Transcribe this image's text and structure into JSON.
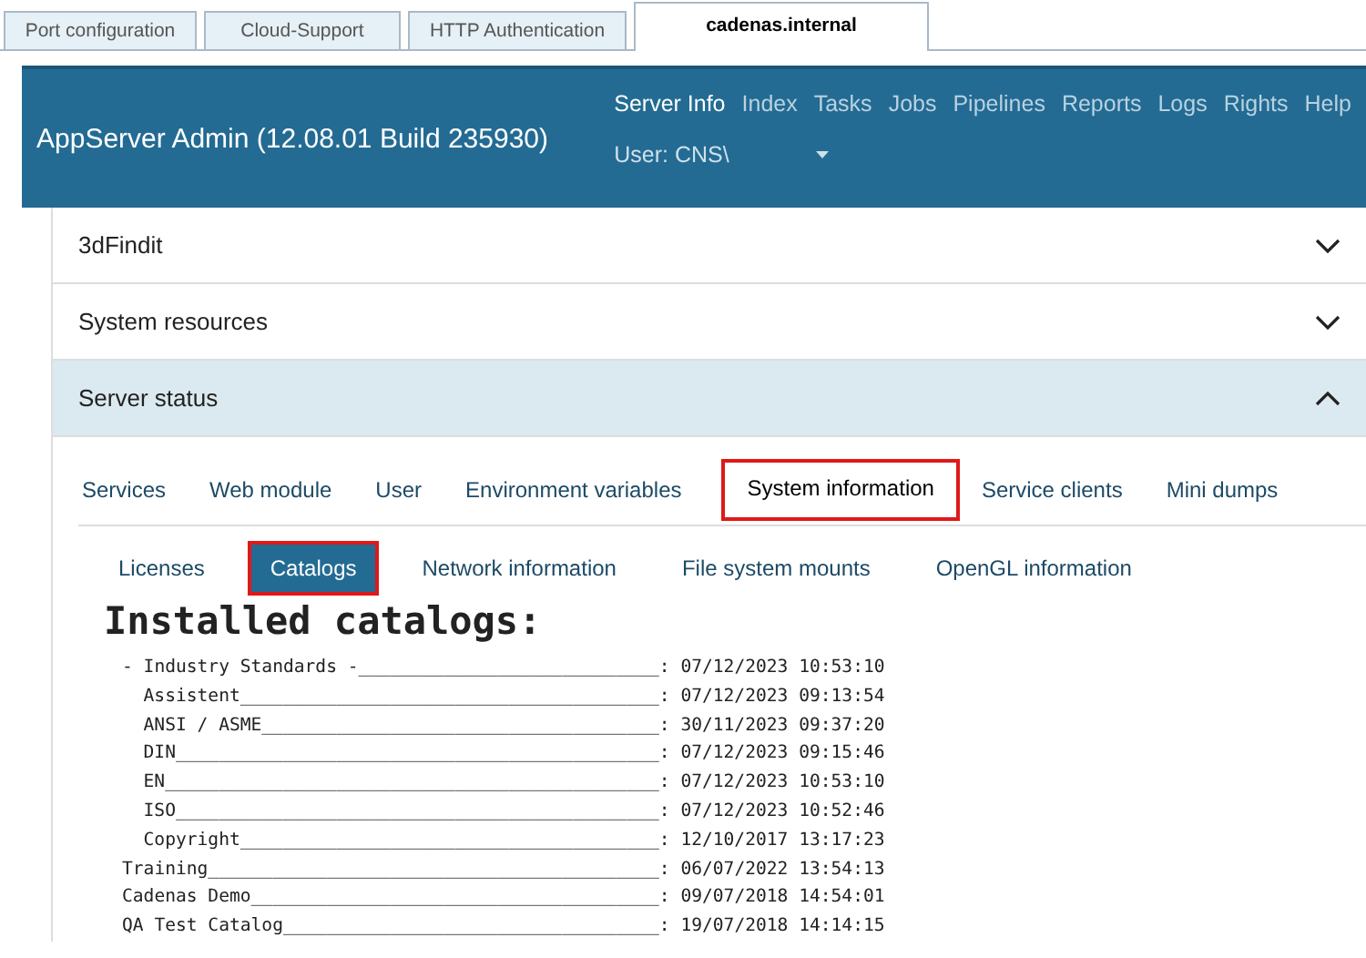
{
  "browser_tabs": [
    {
      "label": "Port configuration",
      "selected": false
    },
    {
      "label": "Cloud-Support",
      "selected": false
    },
    {
      "label": "HTTP Authentication",
      "selected": false
    },
    {
      "label": "cadenas.internal",
      "selected": true
    }
  ],
  "header": {
    "title": "AppServer Admin (12.08.01 Build 235930)",
    "nav": [
      {
        "label": "Server Info",
        "selected": true
      },
      {
        "label": "Index",
        "selected": false
      },
      {
        "label": "Tasks",
        "selected": false
      },
      {
        "label": "Jobs",
        "selected": false
      },
      {
        "label": "Pipelines",
        "selected": false
      },
      {
        "label": "Reports",
        "selected": false
      },
      {
        "label": "Logs",
        "selected": false
      },
      {
        "label": "Rights",
        "selected": false
      },
      {
        "label": "Help",
        "selected": false
      }
    ],
    "user": "User: CNS\\"
  },
  "panels": [
    {
      "title": "3dFindit",
      "expanded": false
    },
    {
      "title": "System resources",
      "expanded": false
    },
    {
      "title": "Server status",
      "expanded": true
    }
  ],
  "tabs": [
    {
      "label": "Services",
      "selected": false
    },
    {
      "label": "Web module",
      "selected": false
    },
    {
      "label": "User",
      "selected": false
    },
    {
      "label": "Environment variables",
      "selected": false
    },
    {
      "label": "System information",
      "selected": true
    },
    {
      "label": "Service clients",
      "selected": false
    },
    {
      "label": "Mini dumps",
      "selected": false
    }
  ],
  "subtabs": [
    {
      "label": "Licenses",
      "selected": false
    },
    {
      "label": "Catalogs",
      "selected": true
    },
    {
      "label": "Network information",
      "selected": false
    },
    {
      "label": "File system mounts",
      "selected": false
    },
    {
      "label": "OpenGL information",
      "selected": false
    }
  ],
  "heading": "Installed catalogs:",
  "catalogs": [
    {
      "line": "- Industry Standards -____________________________: 07/12/2023 10:53:10",
      "children": [
        {
          "line": "Assistent_______________________________________: 07/12/2023 09:13:54"
        },
        {
          "line": "ANSI / ASME_____________________________________: 30/11/2023 09:37:20"
        },
        {
          "line": "DIN_____________________________________________: 07/12/2023 09:15:46"
        },
        {
          "line": "EN______________________________________________: 07/12/2023 10:53:10"
        },
        {
          "line": "ISO_____________________________________________: 07/12/2023 10:52:46"
        },
        {
          "line": "Copyright_______________________________________: 12/10/2017 13:17:23"
        }
      ]
    },
    {
      "line": "Training__________________________________________: 06/07/2022 13:54:13"
    },
    {
      "line": "Cadenas Demo______________________________________: 09/07/2018 14:54:01"
    },
    {
      "line": "QA Test Catalog___________________________________: 19/07/2018 14:14:15"
    }
  ]
}
